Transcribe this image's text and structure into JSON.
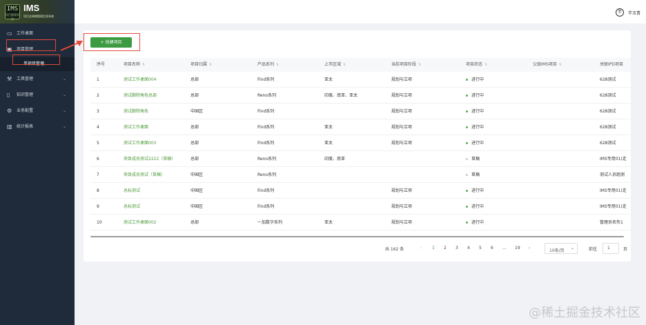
{
  "app": {
    "logo_badge": "IMS",
    "logo_badge_sub": "项目管理系统",
    "title": "IMS",
    "subtitle": "项目全周期管理信息系统"
  },
  "sidebar": {
    "items": [
      {
        "label": "工作桌面",
        "icon": "monitor-icon",
        "has_children": false
      },
      {
        "label": "项目管理",
        "icon": "folder-icon",
        "has_children": false
      },
      {
        "label": "工具管理",
        "icon": "tool-icon",
        "has_children": true
      },
      {
        "label": "知识管理",
        "icon": "book-icon",
        "has_children": true
      },
      {
        "label": "业务配置",
        "icon": "settings-icon",
        "has_children": true
      },
      {
        "label": "统计报表",
        "icon": "chart-icon",
        "has_children": true
      }
    ],
    "sub_item": "单项目管理"
  },
  "header": {
    "avatar_text": "芊",
    "user_name": "芊玉青"
  },
  "toolbar": {
    "create_label": "+ 创建项目"
  },
  "table": {
    "columns": [
      "序号",
      "项目名称",
      "项目归属",
      "产品系列",
      "上市区域",
      "当前项目阶段",
      "项目状态",
      "父级IMS项目",
      "关联IPD项目"
    ],
    "rows": [
      {
        "no": "1",
        "name": "测试工作桌面004",
        "owner": "总部",
        "series": "Find系列",
        "region": "亚太",
        "stage": "规划与立项",
        "status": "进行中",
        "status_color": "#4caf50",
        "parent": "",
        "ipd": "628测试"
      },
      {
        "no": "2",
        "name": "测试删除角色总部",
        "owner": "总部",
        "series": "Reno系列",
        "region": "印度、南亚、亚太",
        "stage": "规划与立项",
        "status": "进行中",
        "status_color": "#4caf50",
        "parent": "",
        "ipd": "628测试"
      },
      {
        "no": "3",
        "name": "测试删除角色",
        "owner": "中国区",
        "series": "Find系列",
        "region": "",
        "stage": "规划与立项",
        "status": "进行中",
        "status_color": "#4caf50",
        "parent": "",
        "ipd": "628测试"
      },
      {
        "no": "4",
        "name": "测试工作桌面",
        "owner": "总部",
        "series": "Find系列",
        "region": "亚太",
        "stage": "规划与立项",
        "status": "进行中",
        "status_color": "#4caf50",
        "parent": "",
        "ipd": "628测试"
      },
      {
        "no": "5",
        "name": "测试工作桌面003",
        "owner": "总部",
        "series": "Find系列",
        "region": "亚太",
        "stage": "规划与立项",
        "status": "进行中",
        "status_color": "#4caf50",
        "parent": "",
        "ipd": "628测试"
      },
      {
        "no": "6",
        "name": "项目成员测试2222（草稿）",
        "owner": "总部",
        "series": "Reno系列",
        "region": "印度、南亚",
        "stage": "",
        "status": "草稿",
        "status_color": "#c8c8c8",
        "parent": "",
        "ipd": "IMS专用01(走"
      },
      {
        "no": "7",
        "name": "项目成员测试（草稿）",
        "owner": "中国区",
        "series": "Reno系列",
        "region": "",
        "stage": "",
        "status": "草稿",
        "status_color": "#c8c8c8",
        "parent": "",
        "ipd": "测试人员跑测"
      },
      {
        "no": "8",
        "name": "总标测试",
        "owner": "中国区",
        "series": "Find系列",
        "region": "",
        "stage": "规划与立项",
        "status": "进行中",
        "status_color": "#4caf50",
        "parent": "",
        "ipd": "IMS专用01(走"
      },
      {
        "no": "9",
        "name": "总标测试",
        "owner": "中国区",
        "series": "Find系列",
        "region": "",
        "stage": "规划与立项",
        "status": "进行中",
        "status_color": "#4caf50",
        "parent": "",
        "ipd": "IMS专用01(走"
      },
      {
        "no": "10",
        "name": "测试工作桌面002",
        "owner": "总部",
        "series": "一加数字系列",
        "region": "亚太",
        "stage": "规划与立项",
        "status": "进行中",
        "status_color": "#4caf50",
        "parent": "",
        "ipd": "管理员名失1"
      }
    ]
  },
  "pagination": {
    "total": "共 162 条",
    "prev": "‹",
    "pages": [
      "1",
      "2",
      "3",
      "4",
      "5",
      "6",
      "...",
      "19"
    ],
    "next": "›",
    "page_size": "10条/页",
    "goto_label": "前往",
    "goto_value": "1",
    "page_suffix": "页"
  },
  "watermark": "@稀土掘金技术社区"
}
